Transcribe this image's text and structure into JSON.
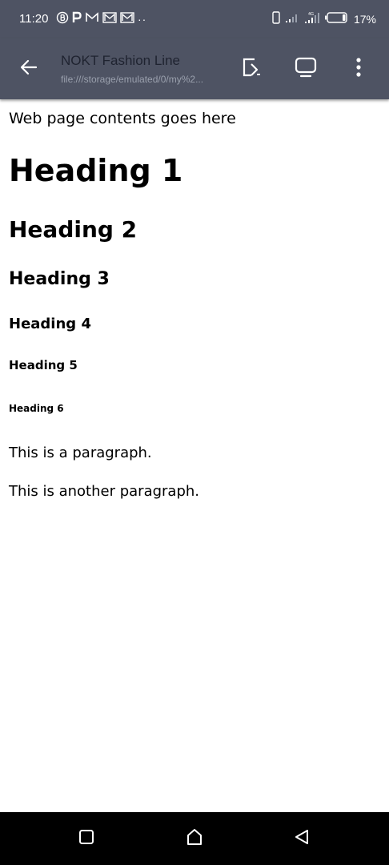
{
  "status_bar": {
    "time": "11:20",
    "battery_percent": "17%",
    "more_indicator": "··",
    "icons": [
      "bitcoin-icon",
      "p-icon",
      "gmail-icon",
      "gmail-icon",
      "gmail-icon",
      "sim-card-icon",
      "signal-icon",
      "signal-icon",
      "battery-icon"
    ]
  },
  "toolbar": {
    "title": "NOKT Fashion Line",
    "url": "file:///storage/emulated/0/my%2...",
    "icons": [
      "back-arrow-icon",
      "open-in-browser-icon",
      "tab-switcher-icon",
      "more-vertical-icon"
    ]
  },
  "content": {
    "intro": "Web page contents goes here",
    "heading1": "Heading 1",
    "heading2": "Heading 2",
    "heading3": "Heading 3",
    "heading4": "Heading 4",
    "heading5": "Heading 5",
    "heading6": "Heading 6",
    "paragraph1": "This is a paragraph.",
    "paragraph2": "This is another paragraph."
  },
  "nav_bar": {
    "icons": [
      "recents-square-icon",
      "home-icon",
      "back-triangle-icon"
    ]
  },
  "colors": {
    "toolbar_bg": "#4e5363",
    "status_bar_bg": "#4e5363",
    "title_text": "#1f2330",
    "url_text": "#9aa0ad",
    "nav_bar_bg": "#000000",
    "content_bg": "#ffffff"
  }
}
